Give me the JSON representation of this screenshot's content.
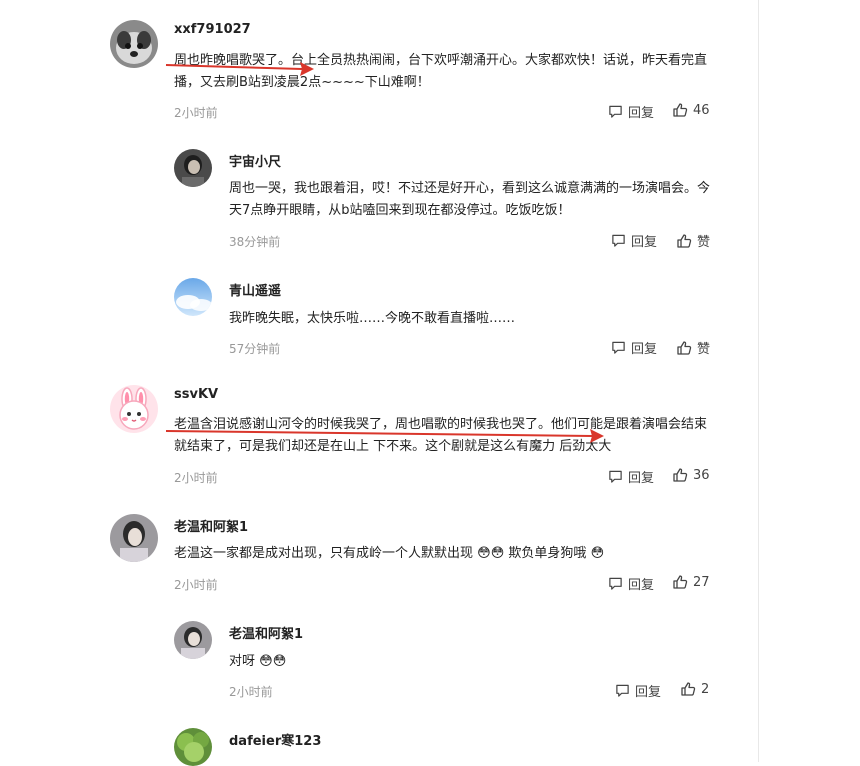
{
  "comments": [
    {
      "user": "xxf791027",
      "text": "周也昨晚唱歌哭了。台上全员热热闹闹，台下欢呼潮涌开心。大家都欢快！话说，昨天看完直播，又去刷B站到凌晨2点~~~~下山难啊！",
      "time": "2小时前",
      "reply": "回复",
      "likes": "46"
    },
    {
      "user": "宇宙小尺",
      "text": "周也一哭，我也跟着泪，哎！不过还是好开心，看到这么诚意满满的一场演唱会。今天7点睁开眼睛，从b站嗑回来到现在都没停过。吃饭吃饭！",
      "time": "38分钟前",
      "reply": "回复",
      "likes": "赞"
    },
    {
      "user": "青山遥遥",
      "text": "我昨晚失眠，太快乐啦……今晚不敢看直播啦……",
      "time": "57分钟前",
      "reply": "回复",
      "likes": "赞"
    },
    {
      "user": "ssvKV",
      "text": "老温含泪说感谢山河令的时候我哭了，周也唱歌的时候我也哭了。他们可能是跟着演唱会结束就结束了，可是我们却还是在山上 下不来。这个剧就是这么有魔力 后劲太大",
      "time": "2小时前",
      "reply": "回复",
      "likes": "36"
    },
    {
      "user": "老温和阿絮1",
      "text_a": "老温这一家都是成对出现，只有成岭一个人默默出现",
      "text_b": "欺负单身狗哦",
      "time": "2小时前",
      "reply": "回复",
      "likes": "27"
    },
    {
      "user": "老温和阿絮1",
      "text": "对呀",
      "time": "2小时前",
      "reply": "回复",
      "likes": "2"
    },
    {
      "user": "dafeier寒123"
    }
  ],
  "emoji": "😳",
  "colors": {
    "arrow": "#d9362b",
    "muted": "#999999",
    "text": "#222222"
  }
}
